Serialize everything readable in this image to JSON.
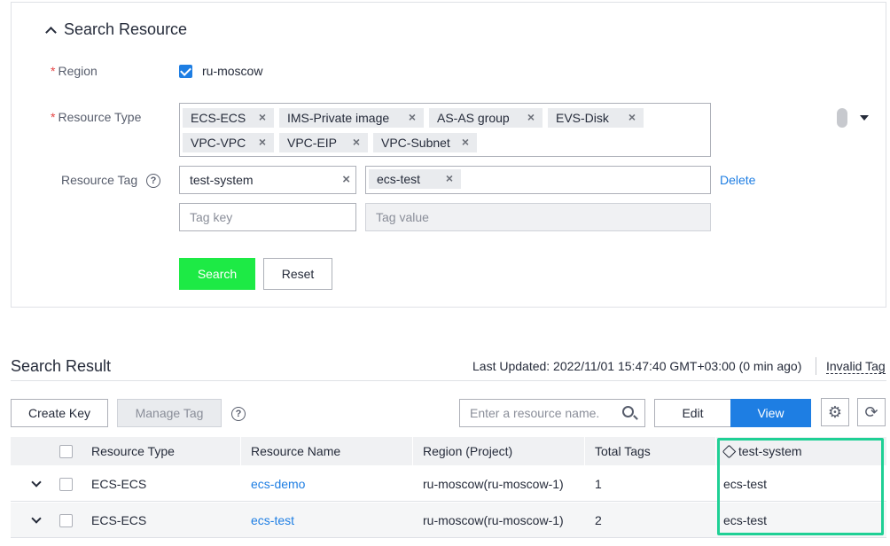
{
  "search_panel": {
    "title": "Search Resource",
    "region_label": "Region",
    "region_value": "ru-moscow",
    "resource_type_label": "Resource Type",
    "resource_types": [
      "ECS-ECS",
      "IMS-Private image",
      "AS-AS group",
      "EVS-Disk",
      "VPC-VPC",
      "VPC-EIP",
      "VPC-Subnet"
    ],
    "resource_tag_label": "Resource Tag",
    "tag_key_value": "test-system",
    "tag_value_chip": "ecs-test",
    "delete_link": "Delete",
    "tag_key_placeholder": "Tag key",
    "tag_value_placeholder": "Tag value",
    "search_button": "Search",
    "reset_button": "Reset",
    "required_mark": "*",
    "help_glyph": "?",
    "remove_glyph": "×"
  },
  "results": {
    "title": "Search Result",
    "last_updated": "Last Updated: 2022/11/01 15:47:40 GMT+03:00 (0 min ago)",
    "invalid_tag": "Invalid Tag",
    "create_key_button": "Create Key",
    "manage_tag_button": "Manage Tag",
    "search_placeholder": "Enter a resource name.",
    "edit_button": "Edit",
    "view_button": "View",
    "settings_glyph": "⚙",
    "refresh_glyph": "⟳",
    "columns": [
      "Resource Type",
      "Resource Name",
      "Region (Project)",
      "Total Tags",
      "test-system"
    ],
    "rows": [
      {
        "type": "ECS-ECS",
        "name": "ecs-demo",
        "region": "ru-moscow(ru-moscow-1)",
        "total": "1",
        "tag": "ecs-test"
      },
      {
        "type": "ECS-ECS",
        "name": "ecs-test",
        "region": "ru-moscow(ru-moscow-1)",
        "total": "2",
        "tag": "ecs-test"
      }
    ]
  },
  "colors": {
    "accent_blue": "#1e7ee3",
    "search_green": "#1dea45",
    "highlight_green": "#1fd095",
    "required_red": "#e54545"
  }
}
